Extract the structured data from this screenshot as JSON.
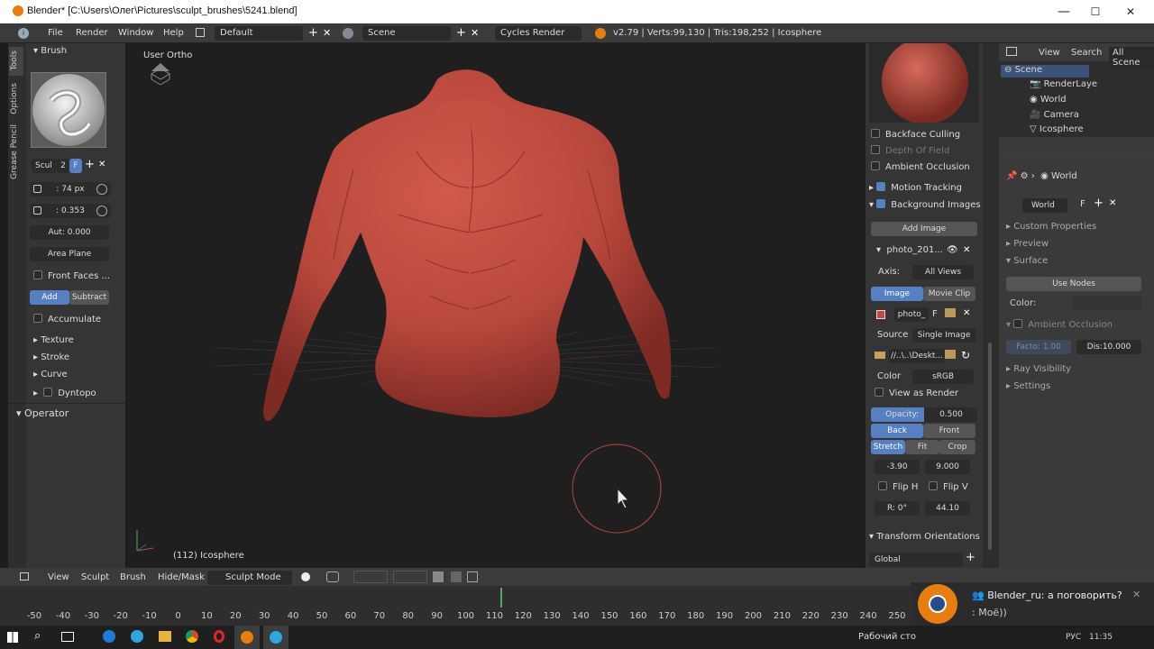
{
  "window": {
    "title": "Blender* [C:\\Users\\Олег\\Pictures\\sculpt_brushes\\5241.blend]",
    "min": "—",
    "max": "☐",
    "close": "✕"
  },
  "topbar": {
    "menus": [
      "File",
      "Render",
      "Window",
      "Help"
    ],
    "layout": "Default",
    "scene": "Scene",
    "engine": "Cycles Render",
    "stats": "v2.79 | Verts:99,130 | Tris:198,252 | Icosphere"
  },
  "tabs": {
    "tools": "Tools",
    "options": "Options",
    "grease": "Grease Pencil"
  },
  "brush": {
    "header": "Brush",
    "name": "Scul",
    "users": "2",
    "fake": "F",
    "radius": ": 74 px",
    "strength": ": 0.353",
    "autosmooth": "Aut: 0.000",
    "plane": "Area Plane",
    "front_faces": "Front Faces ...",
    "add": "Add",
    "subtract": "Subtract",
    "accumulate": "Accumulate",
    "sections": [
      "Texture",
      "Stroke",
      "Curve",
      "Dyntopo"
    ],
    "operator": "Operator"
  },
  "viewport": {
    "view_label": "User Ortho",
    "object_label": "(112) Icosphere",
    "colors": {
      "body": "#b8473c",
      "bg": "#1f1f1f"
    }
  },
  "props": {
    "backface": "Backface Culling",
    "dof": "Depth Of Field",
    "ao": "Ambient Occlusion",
    "motion": "Motion Tracking",
    "bgimages": "Background Images",
    "add_image": "Add Image",
    "photo": "photo_201...",
    "axis_label": "Axis:",
    "axis_val": "All Views",
    "image": "Image",
    "movie": "Movie Clip",
    "photo_short": "photo_",
    "photo_f": "F",
    "source_label": "Source",
    "source_val": "Single Image",
    "path": "//..\\..\\Deskt...",
    "color_label": "Color",
    "color_val": "sRGB",
    "view_render": "View as Render",
    "opacity_label": "Opacity:",
    "opacity_val": "0.500",
    "back": "Back",
    "front": "Front",
    "stretch": "Stretch",
    "fit": "Fit",
    "crop": "Crop",
    "x_off": "-3.90",
    "y_off": "9.000",
    "fliph": "Flip H",
    "flipv": "Flip V",
    "rot": "R: 0°",
    "size": "44.10",
    "transform": "Transform Orientations",
    "global": "Global"
  },
  "outliner": {
    "view": "View",
    "search": "Search",
    "all": "All Scene",
    "items": [
      "Scene",
      "RenderLaye",
      "World",
      "Camera",
      "Icosphere"
    ]
  },
  "world": {
    "crumb": "World",
    "name": "World",
    "f": "F",
    "sections": [
      "Custom Properties",
      "Preview",
      "Surface"
    ],
    "use_nodes": "Use Nodes",
    "color_label": "Color:",
    "ao": "Ambient Occlusion",
    "factor": "Facto: 1.00",
    "distance": "Dis:10.000",
    "ray": "Ray Visibility",
    "settings": "Settings"
  },
  "timeline_header": {
    "items": [
      "View",
      "Sculpt",
      "Brush",
      "Hide/Mask"
    ],
    "mode": "Sculpt Mode"
  },
  "timeline": {
    "ticks": [
      "-50",
      "-40",
      "-30",
      "-20",
      "-10",
      "0",
      "10",
      "20",
      "30",
      "40",
      "50",
      "60",
      "70",
      "80",
      "90",
      "100",
      "110",
      "120",
      "130",
      "140",
      "150",
      "160",
      "170",
      "180",
      "190",
      "200",
      "210",
      "220",
      "230",
      "240",
      "250"
    ],
    "current": "112"
  },
  "notification": {
    "title": "Blender_ru: а поговорить?",
    "text": ": Моё))"
  },
  "taskbar": {
    "desktop": "Рабочий сто",
    "lang": "РУС",
    "time": "11:35"
  }
}
